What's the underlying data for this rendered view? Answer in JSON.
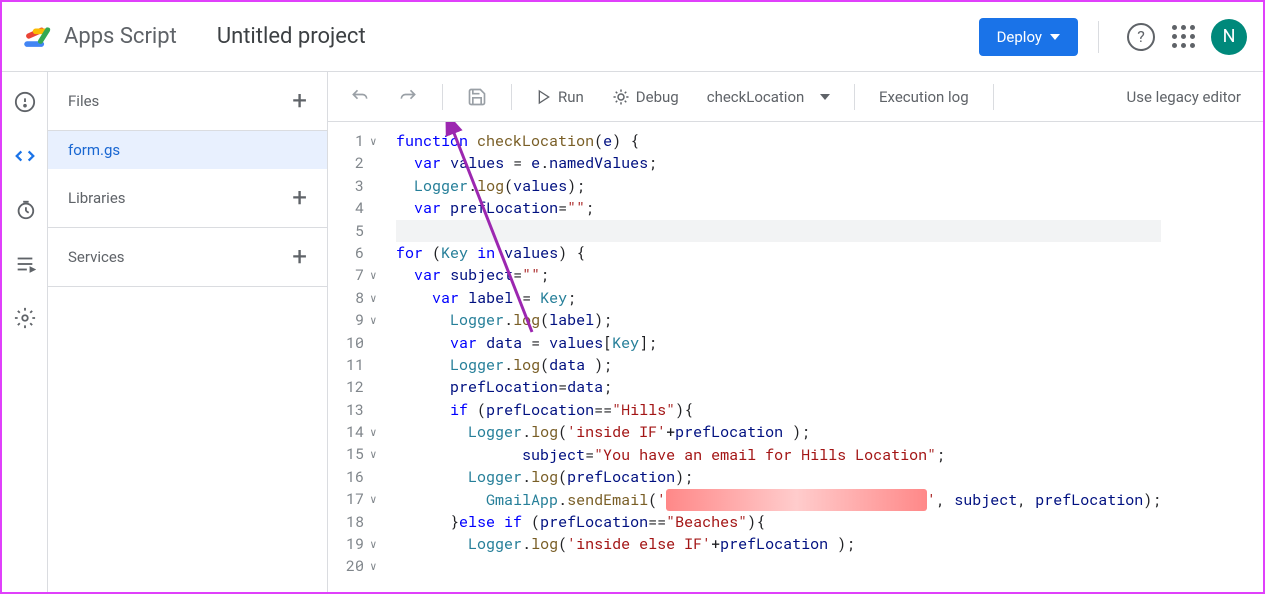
{
  "header": {
    "app_name": "Apps Script",
    "project_title": "Untitled project",
    "deploy_label": "Deploy",
    "avatar_letter": "N"
  },
  "sidebar": {
    "files_label": "Files",
    "libraries_label": "Libraries",
    "services_label": "Services",
    "file": "form.gs"
  },
  "toolbar": {
    "run": "Run",
    "debug": "Debug",
    "function_selected": "checkLocation",
    "exec_log": "Execution log",
    "legacy": "Use legacy editor"
  },
  "code": {
    "lines": [
      {
        "n": "1",
        "fold": "∨",
        "html": "<span class='kw'>function</span> <span class='fn'>checkLocation</span>(<span class='obj'>e</span>) {"
      },
      {
        "n": "2",
        "fold": "",
        "html": "  <span class='kw'>var</span> <span class='obj'>values</span> = <span class='obj'>e</span>.<span class='obj'>namedValues</span>;"
      },
      {
        "n": "3",
        "fold": "",
        "html": "  <span class='id'>Logger</span>.<span class='fn'>log</span>(<span class='obj'>values</span>);"
      },
      {
        "n": "4",
        "fold": "",
        "html": "  <span class='kw'>var</span> <span class='obj'>prefLocation</span>=<span class='str'>\"\"</span>;"
      },
      {
        "n": "5",
        "fold": "",
        "html": "  ",
        "hl": true
      },
      {
        "n": "6",
        "fold": "",
        "html": ""
      },
      {
        "n": "7",
        "fold": "∨",
        "html": "<span class='kw'>for</span> (<span class='id'>Key</span> <span class='kw'>in</span> <span class='obj'>values</span>) {"
      },
      {
        "n": "8",
        "fold": "∨",
        "html": "  <span class='kw'>var</span> <span class='obj'>subject</span>=<span class='str'>\"\"</span>;"
      },
      {
        "n": "9",
        "fold": "∨",
        "html": "    <span class='kw'>var</span> <span class='obj'>label</span> = <span class='id'>Key</span>;"
      },
      {
        "n": "10",
        "fold": "",
        "html": "      <span class='id'>Logger</span>.<span class='fn'>log</span>(<span class='obj'>label</span>);"
      },
      {
        "n": "11",
        "fold": "",
        "html": "      <span class='kw'>var</span> <span class='obj'>data</span> = <span class='obj'>values</span>[<span class='id'>Key</span>];"
      },
      {
        "n": "12",
        "fold": "",
        "html": "      <span class='id'>Logger</span>.<span class='fn'>log</span>(<span class='obj'>data</span> );"
      },
      {
        "n": "13",
        "fold": "",
        "html": "      <span class='obj'>prefLocation</span>=<span class='obj'>data</span>;"
      },
      {
        "n": "14",
        "fold": "∨",
        "html": "      <span class='kw'>if</span> (<span class='obj'>prefLocation</span>==<span class='str'>\"Hills\"</span>){"
      },
      {
        "n": "15",
        "fold": "∨",
        "html": "        <span class='id'>Logger</span>.<span class='fn'>log</span>(<span class='str'>'inside IF'</span>+<span class='obj'>prefLocation</span> );"
      },
      {
        "n": "16",
        "fold": "",
        "html": "              <span class='obj'>subject</span>=<span class='str'>\"You have an email for Hills Location\"</span>;"
      },
      {
        "n": "17",
        "fold": "∨",
        "html": "        <span class='id'>Logger</span>.<span class='fn'>log</span>(<span class='obj'>prefLocation</span>);"
      },
      {
        "n": "18",
        "fold": "",
        "html": "          <span class='id'>GmailApp</span>.<span class='fn'>sendEmail</span>(<span class='str'>'</span><span class='redact'>xxxxxxxxxxxxxxxxxxxxxxxxxxxxx</span><span class='str'>'</span>, <span class='obj'>subject</span>, <span class='obj'>prefLocation</span>);"
      },
      {
        "n": "19",
        "fold": "∨",
        "html": "      }<span class='kw'>else if</span> (<span class='obj'>prefLocation</span>==<span class='str'>\"Beaches\"</span>){"
      },
      {
        "n": "20",
        "fold": "∨",
        "html": "        <span class='id'>Logger</span>.<span class='fn'>log</span>(<span class='str'>'inside else IF'</span>+<span class='obj'>prefLocation</span> );"
      }
    ]
  }
}
